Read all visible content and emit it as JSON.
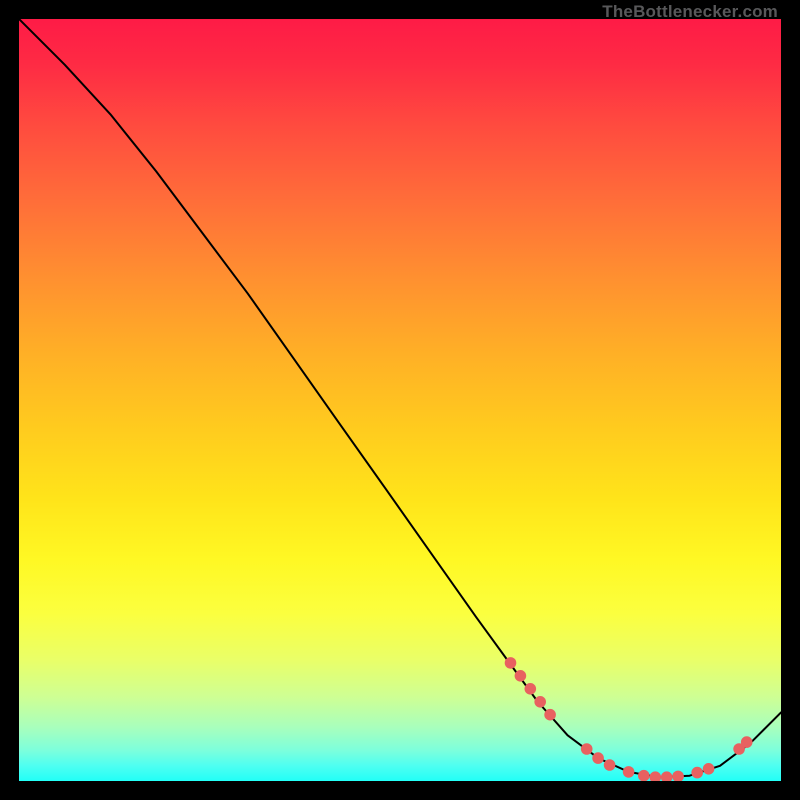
{
  "watermark": "TheBottlenecker.com",
  "colors": {
    "curve": "#000000",
    "dots": "#e86160",
    "frame": "#000000"
  },
  "chart_data": {
    "type": "line",
    "title": "",
    "xlabel": "",
    "ylabel": "",
    "xlim": [
      0,
      100
    ],
    "ylim": [
      0,
      100
    ],
    "series": [
      {
        "name": "curve",
        "x": [
          0,
          6,
          12,
          18,
          24,
          30,
          36,
          42,
          48,
          54,
          60,
          64,
          68,
          72,
          76,
          80,
          84,
          88,
          92,
          96,
          100
        ],
        "y": [
          100,
          94,
          87.5,
          80,
          72,
          64,
          55.5,
          47,
          38.5,
          30,
          21.5,
          16,
          10.5,
          6,
          3,
          1.2,
          0.5,
          0.7,
          2,
          5,
          9
        ]
      }
    ],
    "markers": {
      "name": "drag-handles",
      "points": [
        {
          "x": 64.5,
          "y": 15.5
        },
        {
          "x": 65.8,
          "y": 13.8
        },
        {
          "x": 67.1,
          "y": 12.1
        },
        {
          "x": 68.4,
          "y": 10.4
        },
        {
          "x": 69.7,
          "y": 8.7
        },
        {
          "x": 74.5,
          "y": 4.2
        },
        {
          "x": 76.0,
          "y": 3.0
        },
        {
          "x": 77.5,
          "y": 2.1
        },
        {
          "x": 80.0,
          "y": 1.2
        },
        {
          "x": 82.0,
          "y": 0.7
        },
        {
          "x": 83.5,
          "y": 0.5
        },
        {
          "x": 85.0,
          "y": 0.5
        },
        {
          "x": 86.5,
          "y": 0.6
        },
        {
          "x": 89.0,
          "y": 1.1
        },
        {
          "x": 90.5,
          "y": 1.6
        },
        {
          "x": 94.5,
          "y": 4.2
        },
        {
          "x": 95.5,
          "y": 5.1
        }
      ]
    }
  }
}
